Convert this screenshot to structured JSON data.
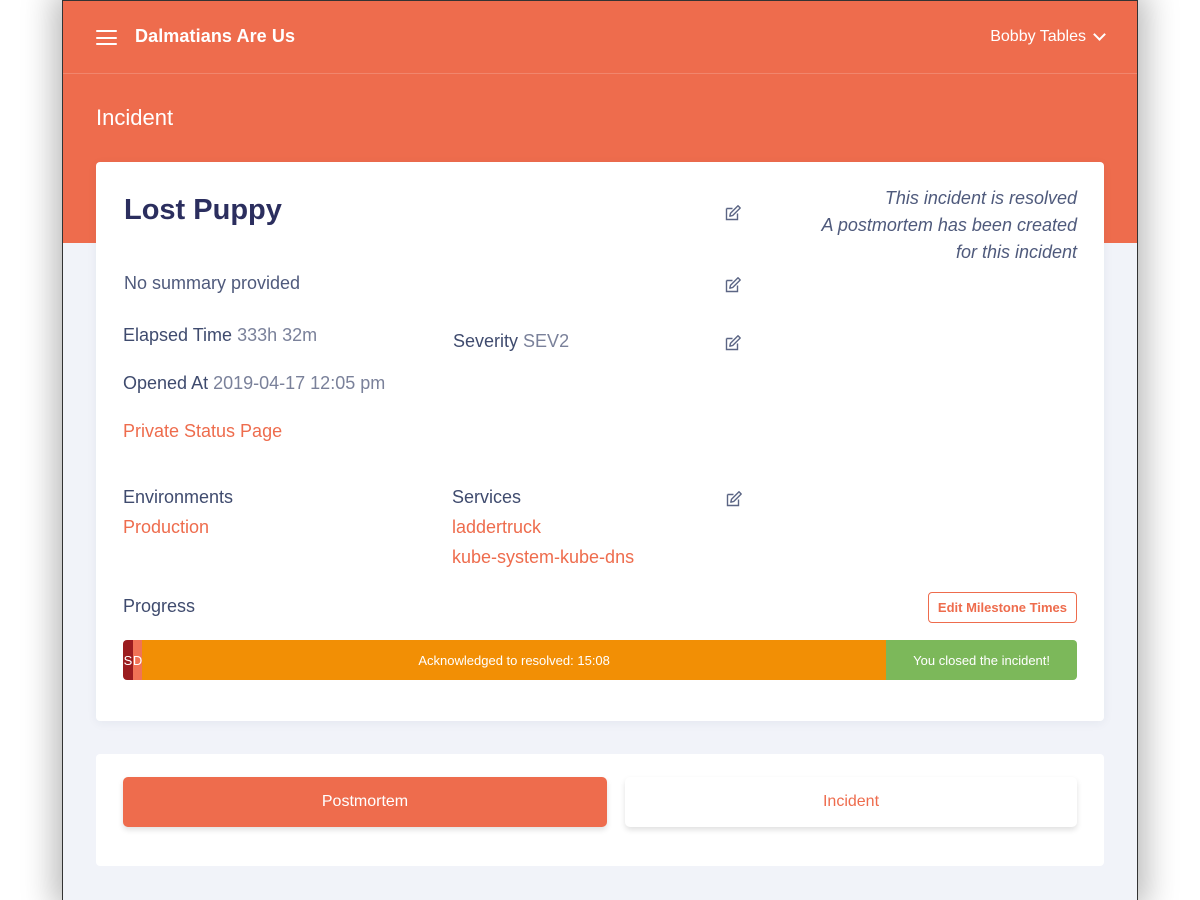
{
  "header": {
    "menu_icon": "hamburger-icon",
    "brand": "Dalmatians Are Us",
    "user": "Bobby Tables",
    "user_menu_icon": "chevron-down-icon"
  },
  "page": {
    "title": "Incident"
  },
  "incident": {
    "title": "Lost Puppy",
    "status_lines": [
      "This incident is resolved",
      "A postmortem has been created",
      "for this incident"
    ],
    "summary": "No summary provided",
    "elapsed_label": "Elapsed Time",
    "elapsed_value": "333h 32m",
    "severity_label": "Severity",
    "severity_value": "SEV2",
    "opened_label": "Opened At",
    "opened_value": "2019-04-17 12:05 pm",
    "status_page_link": "Private Status Page",
    "environments_label": "Environments",
    "environments": [
      "Production"
    ],
    "services_label": "Services",
    "services": [
      "laddertruck",
      "kube-system-kube-dns"
    ],
    "edit_icon": "edit-icon"
  },
  "progress": {
    "label": "Progress",
    "edit_button": "Edit Milestone Times",
    "segments": [
      {
        "label": "S",
        "fraction": 0.0105,
        "color": "#9b1c1f"
      },
      {
        "label": "D",
        "fraction": 0.0095,
        "color": "#f07356"
      },
      {
        "label": "Acknowledged to resolved: 15:08",
        "fraction": 0.78,
        "color": "#f28f05"
      },
      {
        "label": "You closed the incident!",
        "fraction": 0.2,
        "color": "#7cb85a"
      }
    ]
  },
  "tabs": {
    "postmortem": "Postmortem",
    "incident": "Incident"
  },
  "colors": {
    "brand": "#ee6c4d",
    "title": "#2b2e5e",
    "text": "#3f4b6e"
  }
}
